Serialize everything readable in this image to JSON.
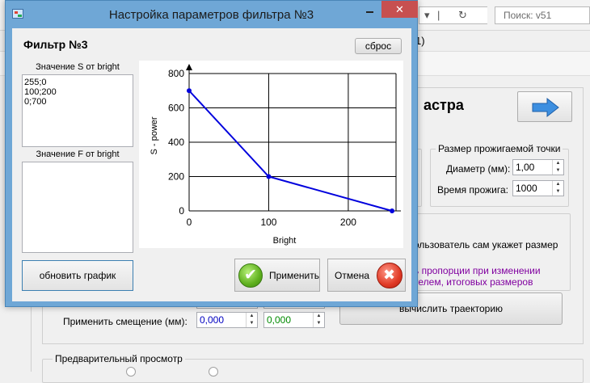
{
  "browser": {
    "search_placeholder": "Поиск: v51",
    "menu_tail": "1)"
  },
  "background": {
    "section_title": "астра",
    "burn_point_group_title": "Размер прожигаемой точки",
    "diameter_label": "Диаметр (мм):",
    "diameter_value": "1,00",
    "burn_time_label": "Время прожига:",
    "burn_time_value": "1000",
    "user_size_text": "ользователь сам укажет размер",
    "proportion_text_1": "ь пропорции при изменении",
    "proportion_text_2": "телем, итоговых размеров",
    "apply_offset_label": "Применить смещение (мм):",
    "offset_x": "0,000",
    "offset_y": "0,000",
    "compute_button": "вычислить траекторию",
    "preview_group_title": "Предварительный просмотр"
  },
  "dialog": {
    "title": "Настройка параметров фильтра №3",
    "close_glyph": "✕",
    "filter_title": "Фильтр №3",
    "reset_button": "сброс",
    "s_label": "Значение S от bright",
    "s_text": "255;0\n100;200\n0;700",
    "f_label": "Значение F от bright",
    "f_text": "",
    "update_button": "обновить график",
    "apply_button": "Применить",
    "cancel_button": "Отмена"
  },
  "chart_data": {
    "type": "line",
    "xlabel": "Bright",
    "ylabel": "S - power",
    "xlim": [
      0,
      260
    ],
    "ylim": [
      0,
      800
    ],
    "x_ticks": [
      0,
      100,
      200
    ],
    "y_ticks": [
      0,
      200,
      400,
      600,
      800
    ],
    "grid": true,
    "line_color": "#0000dd",
    "series": [
      {
        "x": [
          0,
          100,
          255
        ],
        "y": [
          700,
          200,
          0
        ]
      }
    ]
  }
}
